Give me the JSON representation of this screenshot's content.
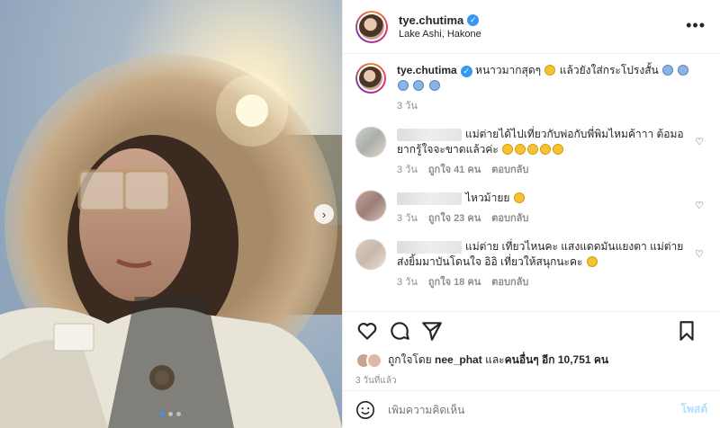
{
  "post": {
    "username": "tye.chutima",
    "location": "Lake Ashi, Hakone"
  },
  "caption": {
    "username": "tye.chutima",
    "text": "หนาวมากสุดๆ",
    "text2": "แล้วยังใส่กระโปรงสั้น",
    "time": "3 วัน"
  },
  "comments": [
    {
      "text": "แม่ต่ายได้ไปเที่ยวกับพ่อกับพี่พิมไหมค้าาา ต้อมอยากรู้ใจจะขาดแล้วค่ะ",
      "time": "3 วัน",
      "likes": "ถูกใจ 41 คน",
      "reply": "ตอบกลับ"
    },
    {
      "text": "ไหวม้ายย",
      "time": "3 วัน",
      "likes": "ถูกใจ 23 คน",
      "reply": "ตอบกลับ"
    },
    {
      "text": "แม่ต่าย เที่ยวไหนคะ แสงแดดมันแยงตา แม่ต่ายส่งยิ้มมาบันโดนใจ อิอิ เที่ยวให้สนุกนะคะ",
      "time": "3 วัน",
      "likes": "ถูกใจ 18 คน",
      "reply": "ตอบกลับ"
    }
  ],
  "likes": {
    "prefix": "ถูกใจโดย",
    "user": "nee_phat",
    "middle": "และ",
    "others": "คนอื่นๆ อีก 10,751 คน"
  },
  "time_ago": "3 วันที่แล้ว",
  "add_comment": {
    "placeholder": "เพิ่มความคิดเห็น",
    "post_label": "โพสต์"
  },
  "icons": {
    "next": "chevron-right-icon",
    "more": "more-horizontal-icon",
    "verified": "verified-badge-icon"
  },
  "carousel": {
    "count": 3,
    "active": 1
  }
}
